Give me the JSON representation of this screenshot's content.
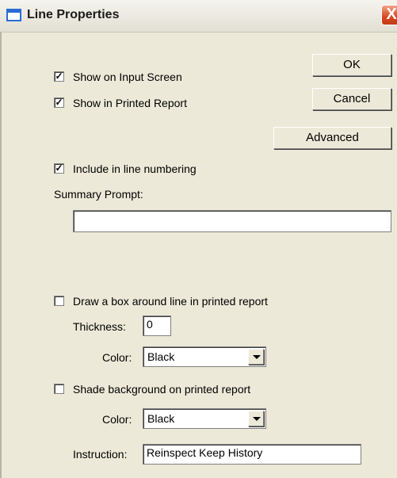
{
  "window": {
    "title": "Line Properties",
    "close_glyph": "X"
  },
  "buttons": {
    "ok": "OK",
    "cancel": "Cancel",
    "advanced": "Advanced"
  },
  "options": {
    "show_input": {
      "label": "Show on Input Screen",
      "checked": true,
      "mark": "✓"
    },
    "show_printed": {
      "label": "Show in Printed Report",
      "checked": true,
      "mark": "✓"
    },
    "line_numbering": {
      "label": "Include in line numbering",
      "checked": true,
      "mark": "✓"
    },
    "draw_box": {
      "label": "Draw a box around line in printed report",
      "checked": false,
      "mark": ""
    },
    "shade_bg": {
      "label": "Shade background on printed report",
      "checked": false,
      "mark": ""
    }
  },
  "summary": {
    "label": "Summary Prompt:",
    "value": ""
  },
  "box": {
    "thickness_label": "Thickness:",
    "thickness_value": "0",
    "color_label": "Color:",
    "color_value": "Black"
  },
  "shade": {
    "color_label": "Color:",
    "color_value": "Black"
  },
  "instruction": {
    "label": "Instruction:",
    "value": "Reinspect Keep History"
  }
}
